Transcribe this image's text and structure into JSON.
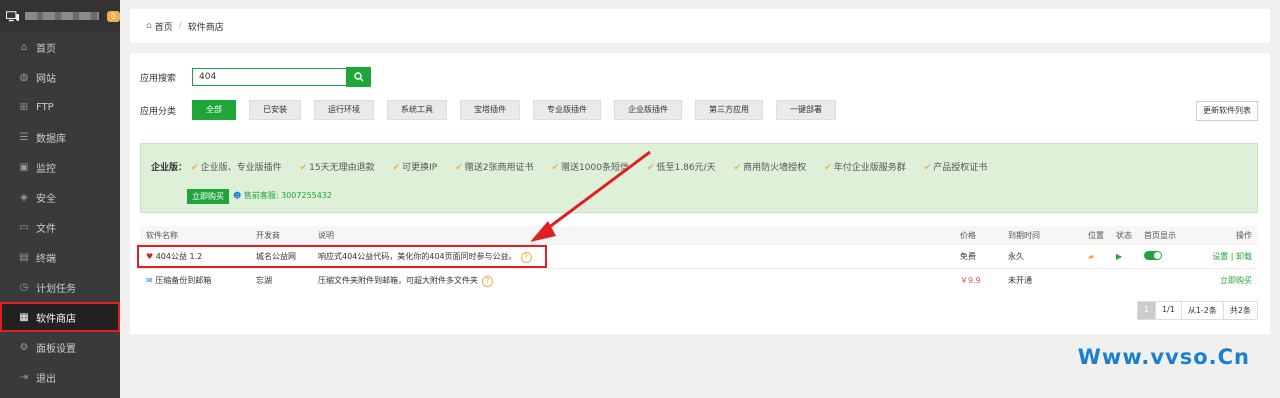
{
  "sidebar": {
    "badge": "0",
    "items": [
      {
        "label": "首页",
        "icon": "home-icon"
      },
      {
        "label": "网站",
        "icon": "globe-icon"
      },
      {
        "label": "FTP",
        "icon": "ftp-icon"
      },
      {
        "label": "数据库",
        "icon": "database-icon"
      },
      {
        "label": "监控",
        "icon": "monitor-icon"
      },
      {
        "label": "安全",
        "icon": "shield-icon"
      },
      {
        "label": "文件",
        "icon": "folder-icon"
      },
      {
        "label": "终端",
        "icon": "terminal-icon"
      },
      {
        "label": "计划任务",
        "icon": "clock-icon"
      },
      {
        "label": "软件商店",
        "icon": "grid-icon"
      },
      {
        "label": "面板设置",
        "icon": "settings-icon"
      },
      {
        "label": "退出",
        "icon": "logout-icon"
      }
    ]
  },
  "breadcrumb": {
    "home": "首页",
    "sep": "/",
    "current": "软件商店"
  },
  "search": {
    "label": "应用搜索",
    "value": "404"
  },
  "categories": {
    "label": "应用分类",
    "items": [
      "全部",
      "已安装",
      "运行环境",
      "系统工具",
      "宝塔插件",
      "专业版插件",
      "企业版插件",
      "第三方应用",
      "一键部署"
    ]
  },
  "update_button": "更新软件列表",
  "promo": {
    "title": "企业版：",
    "features": [
      "企业版、专业版插件",
      "15天无理由退款",
      "可更换IP",
      "赠送2张商用证书",
      "赠送1000条短信",
      "低至1.86元/天",
      "商用防火墙授权",
      "年付企业版服务群",
      "产品授权证书"
    ],
    "buy": "立即购买",
    "service": "售前客服: 3007255432"
  },
  "table": {
    "headers": [
      "软件名称",
      "开发商",
      "说明",
      "价格",
      "到期时间",
      "位置",
      "状态",
      "首页显示",
      "操作"
    ],
    "rows": [
      {
        "name": "404公益 1.2",
        "dev": "城名公益网",
        "desc": "响应式404公益代码，美化你的404页面同时参与公益。",
        "price": "免费",
        "expire": "永久",
        "ops": "设置 | 卸载"
      },
      {
        "name": "压缩备份到邮箱",
        "dev": "忘湖",
        "desc": "压缩文件夹附件到邮箱，可超大附件多文件夹",
        "price": "￥9.9",
        "expire": "未开通",
        "ops": "立即购买"
      }
    ]
  },
  "pager": {
    "page": "1",
    "total_pages": "1/1",
    "range": "从1-2条",
    "count": "共2条"
  },
  "watermark": "Www.vvso.Cn"
}
